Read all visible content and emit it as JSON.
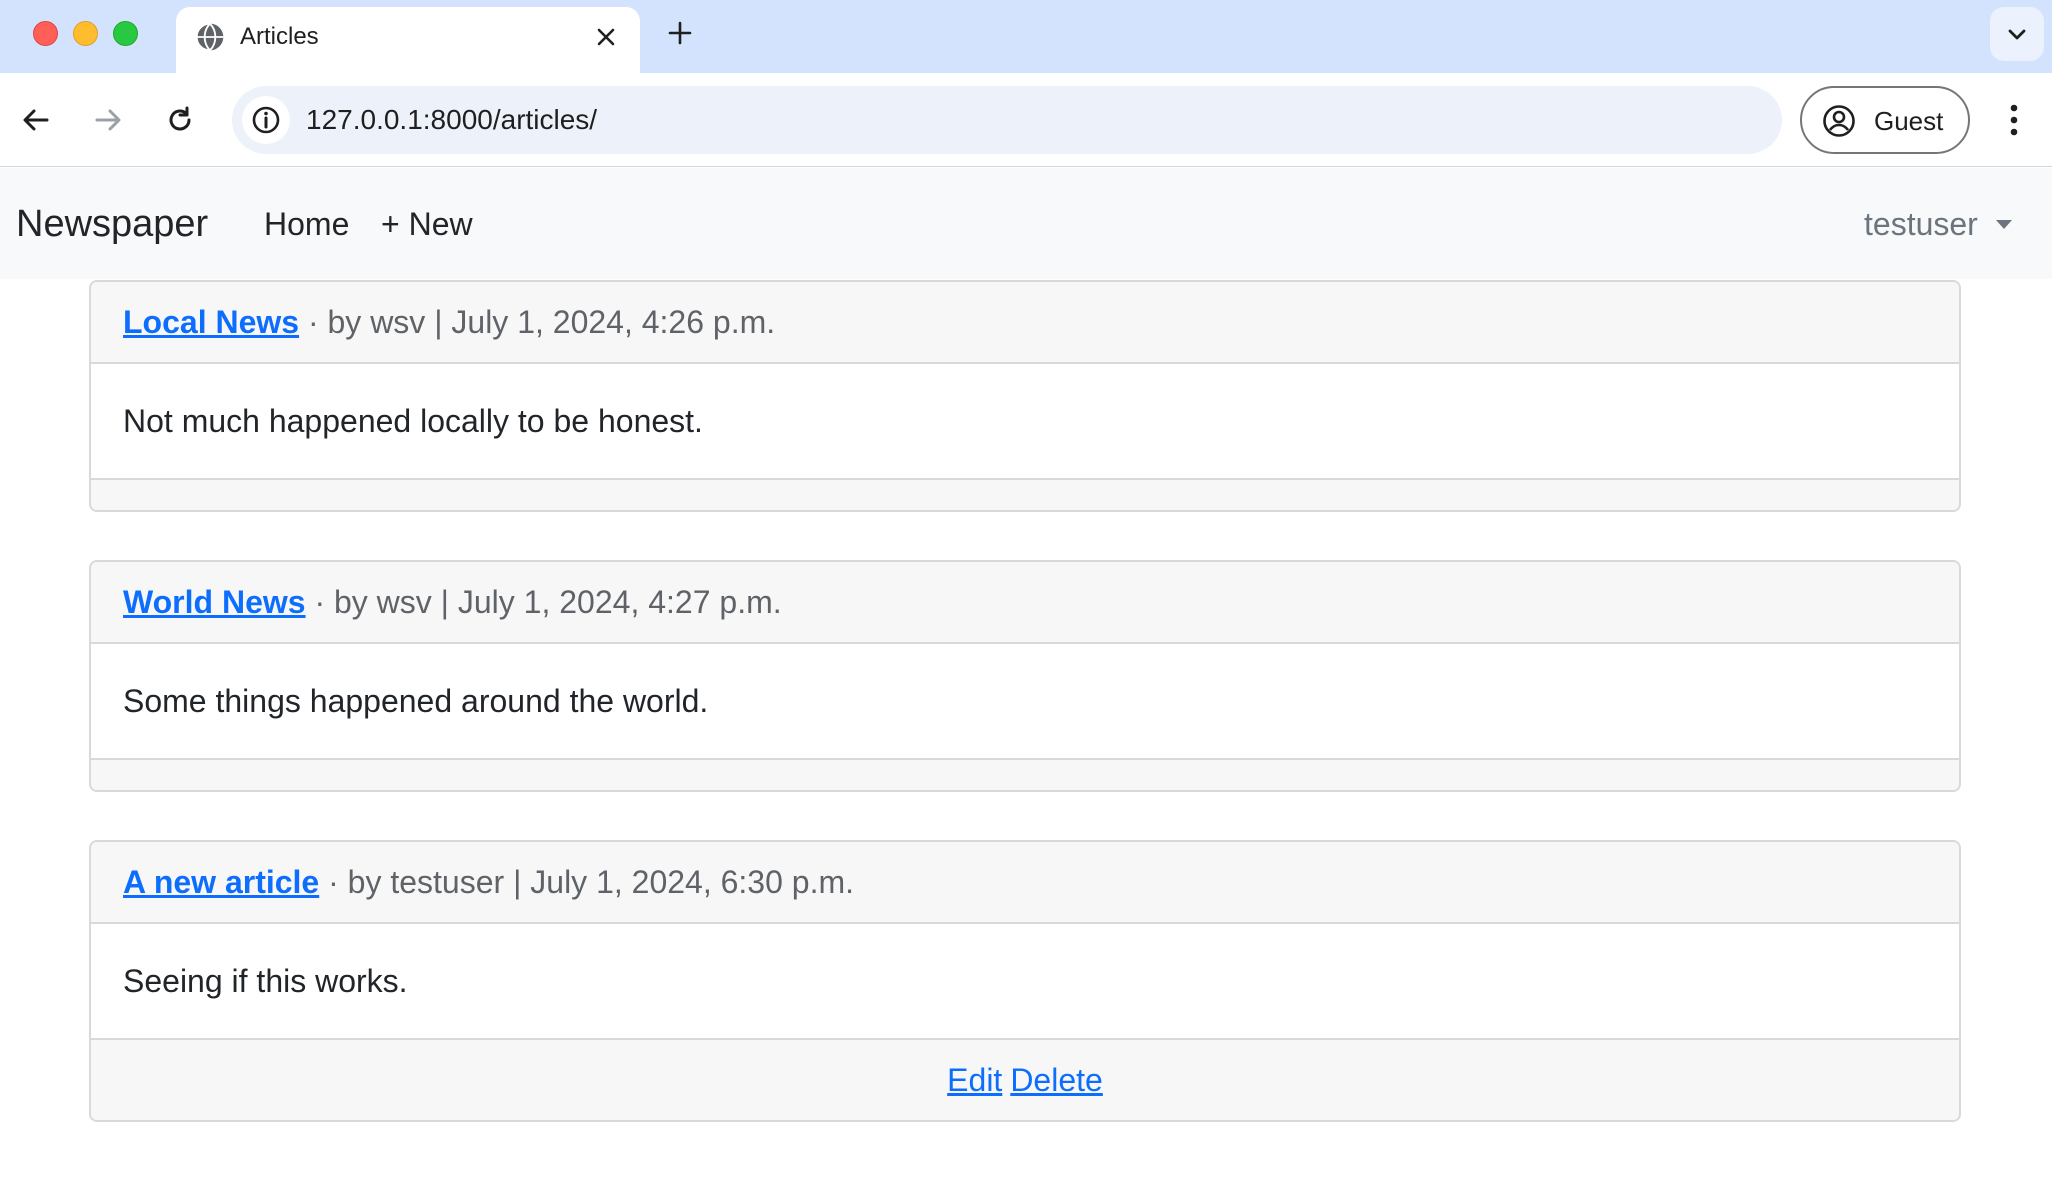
{
  "browser": {
    "tab_title": "Articles",
    "url": "127.0.0.1:8000/articles/",
    "profile_label": "Guest"
  },
  "navbar": {
    "brand": "Newspaper",
    "links": [
      {
        "label": "Home"
      },
      {
        "label": "+ New"
      }
    ],
    "user": "testuser"
  },
  "articles": [
    {
      "title": "Local News",
      "meta": " · by wsv | July 1, 2024, 4:26 p.m.",
      "body": "Not much happened locally to be honest."
    },
    {
      "title": "World News",
      "meta": " · by wsv | July 1, 2024, 4:27 p.m.",
      "body": "Some things happened around the world."
    },
    {
      "title": "A new article",
      "meta": " · by testuser | July 1, 2024, 6:30 p.m.",
      "body": "Seeing if this works.",
      "actions": {
        "edit": "Edit",
        "delete": "Delete"
      }
    }
  ],
  "colors": {
    "link": "#0d6efd",
    "navbar_bg": "#f8f9fa",
    "tabstrip_bg": "#d3e3fd"
  }
}
